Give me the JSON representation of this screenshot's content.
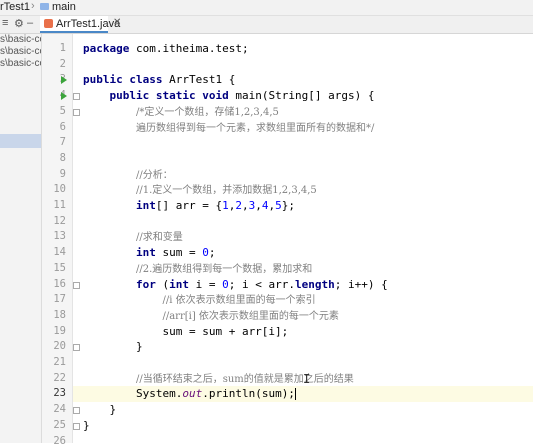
{
  "breadcrumb": {
    "project": "rTest1",
    "branch": "main"
  },
  "tabs": [
    {
      "label": "ArrTest1.java"
    }
  ],
  "project_panel": {
    "items": [
      "s\\basic-code",
      "s\\basic-code",
      "s\\basic-code"
    ]
  },
  "editor": {
    "current_line": 23,
    "lines": [
      {
        "n": "1",
        "text": "package com.itheima.test;"
      },
      {
        "n": "2",
        "text": ""
      },
      {
        "n": "3",
        "text": "public class ArrTest1 {"
      },
      {
        "n": "4",
        "text": "    public static void main(String[] args) {"
      },
      {
        "n": "5",
        "text": "        /*定义一个数组，存储1,2,3,4,5"
      },
      {
        "n": "6",
        "text": "        遍历数组得到每一个元素，求数组里面所有的数据和*/"
      },
      {
        "n": "7",
        "text": ""
      },
      {
        "n": "8",
        "text": ""
      },
      {
        "n": "9",
        "text": "        //分析："
      },
      {
        "n": "10",
        "text": "        //1.定义一个数组，并添加数据1,2,3,4,5"
      },
      {
        "n": "11",
        "text": "        int[] arr = {1,2,3,4,5};"
      },
      {
        "n": "12",
        "text": ""
      },
      {
        "n": "13",
        "text": "        //求和变量"
      },
      {
        "n": "14",
        "text": "        int sum = 0;"
      },
      {
        "n": "15",
        "text": "        //2.遍历数组得到每一个数据，累加求和"
      },
      {
        "n": "16",
        "text": "        for (int i = 0; i < arr.length; i++) {"
      },
      {
        "n": "17",
        "text": "            //i 依次表示数组里面的每一个索引"
      },
      {
        "n": "18",
        "text": "            //arr[i] 依次表示数组里面的每一个元素"
      },
      {
        "n": "19",
        "text": "            sum = sum + arr[i];"
      },
      {
        "n": "20",
        "text": "        }"
      },
      {
        "n": "21",
        "text": ""
      },
      {
        "n": "22",
        "text": "        //当循环结束之后，sum的值就是累加之后的结果"
      },
      {
        "n": "23",
        "text": "        System.out.println(sum);"
      },
      {
        "n": "24",
        "text": "    }"
      },
      {
        "n": "25",
        "text": "}"
      },
      {
        "n": "26",
        "text": ""
      }
    ]
  },
  "colors": {
    "keyword": "#000080",
    "comment": "#808080",
    "number": "#0000ff",
    "field": "#660e7a",
    "run": "#3ba33b",
    "current_line": "#fdfbe3"
  },
  "icons": [
    "folder-icon",
    "branch-icon",
    "settings-icon",
    "minus-icon",
    "run-icon",
    "java-file-icon",
    "close-icon"
  ]
}
